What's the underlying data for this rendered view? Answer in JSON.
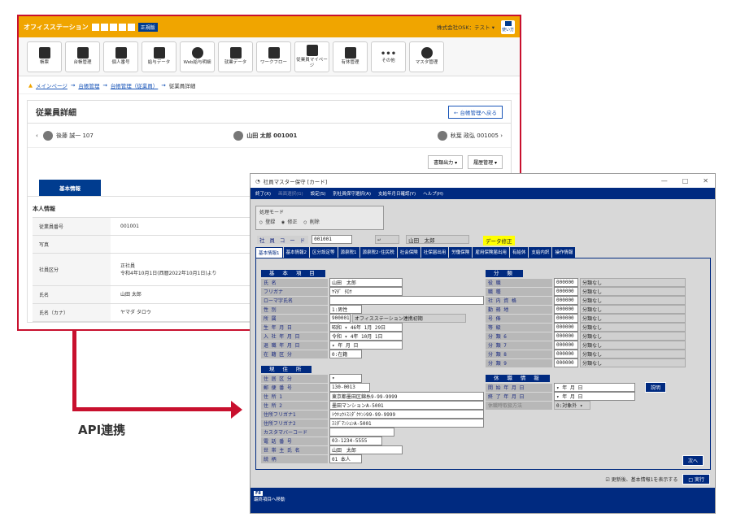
{
  "web": {
    "brand": "オフィスステーション",
    "badge": "正規版",
    "company": "株式会社OSK：テスト ▾",
    "help": "使い方",
    "menu": [
      "帳票",
      "台帳管理",
      "個人番号",
      "給与データ",
      "Web給与明細",
      "就業データ",
      "ワークフロー",
      "従業員マイページ",
      "有休管理",
      "その他",
      "マスタ管理"
    ],
    "breadcrumb": {
      "home": "メインページ",
      "b1": "台帳管理",
      "b2": "台帳管理（従業員）",
      "current": "従業員詳細"
    },
    "title": "従業員詳細",
    "back": "← 台帳管理へ戻る",
    "prev": "後藤 誠一 107",
    "current_emp": "山田 太郎 001001",
    "next": "秋葉 政弘 001005",
    "btn_output": "書類出力 ▾",
    "btn_history": "履歴管理 ▾",
    "tab": "基本情報",
    "section": "本人情報",
    "rows": [
      {
        "k": "従業員番号",
        "v": "001001"
      },
      {
        "k": "写真",
        "v": ""
      },
      {
        "k": "社員区分",
        "v": "正社員"
      },
      {
        "k": "氏名",
        "v": "山田 太郎"
      },
      {
        "k": "氏名（カナ）",
        "v": "ヤマダ タロウ"
      }
    ],
    "row_sub": "令和4年10月1日(西暦2022年10月1日)より"
  },
  "api_label": "API連携",
  "desk": {
    "title": "社員マスター保守 [カード]",
    "menu": [
      "終了(X)",
      "画面選択(G)",
      "設定(S)",
      "別社員保守選択(A)",
      "支給年月日確認(Y)",
      "ヘルプ(H)"
    ],
    "mode_label": "処理モード",
    "modes": [
      "○ 登録",
      "◉ 修正",
      "○ 削除"
    ],
    "code_label": "社 員 コ ー ド",
    "code": "001001",
    "name_disp": "山田　太郎",
    "warn": "データ修正",
    "tabs": [
      "基本情報1",
      "基本情報2",
      "区分設定等",
      "源泉税1",
      "源泉税2･住民税",
      "社会保険",
      "社保届出用",
      "労働保険",
      "雇用保険届出用",
      "有給休",
      "支給内訳",
      "操作情報"
    ],
    "g1": "基 本 項 目",
    "f_name_l": "氏 名",
    "f_name": "山田　太郎",
    "f_kana_l": "フリガナ",
    "f_kana": "ﾔﾏﾀﾞ ﾀﾛｳ",
    "f_roma_l": "ローマ字氏名",
    "f_sex_l": "性 別",
    "f_sex": "1:男性",
    "f_dept_l": "所 属",
    "f_dept_code": "900001",
    "f_dept": "オフィスステーション連携初期",
    "f_birth_l": "生 年 月 日",
    "f_birth": "昭和 ▾ 46年 1月 29日",
    "f_join_l": "入 社 年 月 日",
    "f_join": "令和 ▾ 4年 10月 1日",
    "f_leave_l": "退 職 年 月 日",
    "f_leave": "▾ 年 月 日",
    "f_status_l": "在 籍 区 分",
    "f_status": "0:在籍",
    "g2": "現 住 所",
    "f_res_l": "住 居 区 分",
    "f_zip_l": "郵 便 番 号",
    "f_zip": "130-0013",
    "f_addr1_l": "住 所 1",
    "f_addr1": "東京都墨田区錦糸9-99-9999",
    "f_addr2_l": "住 所 2",
    "f_addr2": "墨田マンションA-5001",
    "f_addk1_l": "住所フリガナ1",
    "f_addk1": "ﾄｳｷｮｳﾄｽﾐﾀﾞｸｷﾝｼ99-99-9999",
    "f_addk2_l": "住所フリガナ2",
    "f_addk2": "ｽﾐﾀﾞﾏﾝｼｮﾝA-5001",
    "f_kasu_l": "カスタマバーコード",
    "f_tel_l": "電 話 番 号",
    "f_tel": "03-1234-5555",
    "f_head_l": "世 帯 主 氏 名",
    "f_head": "山田　太郎",
    "f_rel_l": "続 柄",
    "f_rel": "01 本人",
    "g3": "分 類",
    "cls": [
      {
        "l": "役 職",
        "c": "000000",
        "v": "分類なし"
      },
      {
        "l": "職 種",
        "c": "000000",
        "v": "分類なし"
      },
      {
        "l": "社 内 資 格",
        "c": "000000",
        "v": "分類なし"
      },
      {
        "l": "勤 務 地",
        "c": "000000",
        "v": "分類なし"
      },
      {
        "l": "号 俸",
        "c": "000000",
        "v": "分類なし"
      },
      {
        "l": "等 級",
        "c": "000000",
        "v": "分類なし"
      },
      {
        "l": "分 類 6",
        "c": "000000",
        "v": "分類なし"
      },
      {
        "l": "分 類 7",
        "c": "000000",
        "v": "分類なし"
      },
      {
        "l": "分 類 8",
        "c": "000000",
        "v": "分類なし"
      },
      {
        "l": "分 類 9",
        "c": "000000",
        "v": "分類なし"
      }
    ],
    "g4": "休 職 情 報",
    "k_start_l": "開 始 年 月 日",
    "k_end_l": "終 了 年 月 日",
    "k_ymd": "▾ 年 月 日",
    "k_btn": "説明",
    "k_type_l": "休職時取扱方法",
    "k_type": "0:対象外 ▾",
    "next_btn": "次へ",
    "chk": "☑ 更新後、基本情報1を表示する",
    "run": "□ 実行",
    "f8": "F8",
    "status": "最終項目へ移動"
  }
}
